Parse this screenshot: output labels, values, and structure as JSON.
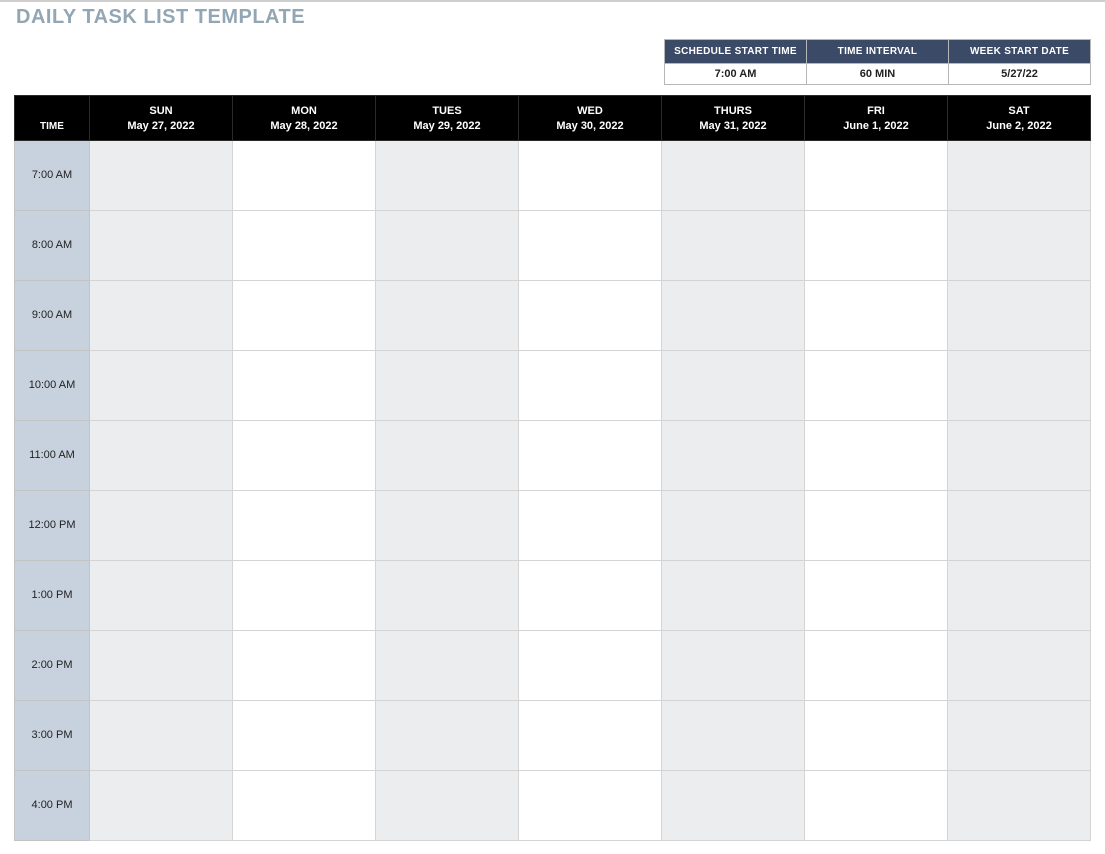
{
  "title": "DAILY TASK LIST TEMPLATE",
  "settings": {
    "headers": {
      "start_time": "SCHEDULE START TIME",
      "interval": "TIME INTERVAL",
      "week_start": "WEEK START DATE"
    },
    "values": {
      "start_time": "7:00 AM",
      "interval": "60 MIN",
      "week_start": "5/27/22"
    }
  },
  "grid": {
    "time_header": "TIME",
    "days": [
      {
        "name": "SUN",
        "date": "May 27, 2022"
      },
      {
        "name": "MON",
        "date": "May 28, 2022"
      },
      {
        "name": "TUES",
        "date": "May 29, 2022"
      },
      {
        "name": "WED",
        "date": "May 30, 2022"
      },
      {
        "name": "THURS",
        "date": "May 31, 2022"
      },
      {
        "name": "FRI",
        "date": "June 1, 2022"
      },
      {
        "name": "SAT",
        "date": "June 2, 2022"
      }
    ],
    "times": [
      "7:00 AM",
      "8:00 AM",
      "9:00 AM",
      "10:00 AM",
      "11:00 AM",
      "12:00 PM",
      "1:00 PM",
      "2:00 PM",
      "3:00 PM",
      "4:00 PM"
    ]
  }
}
